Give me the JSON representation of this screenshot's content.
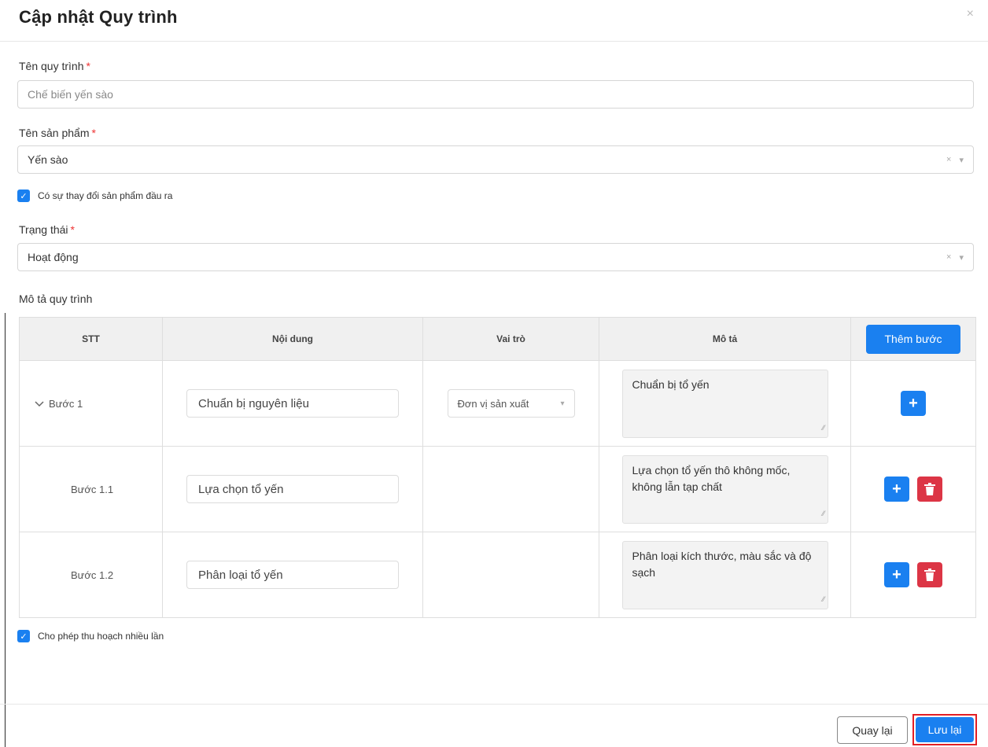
{
  "modal": {
    "title": "Cập nhật Quy trình",
    "close": "×"
  },
  "form": {
    "process_name": {
      "label": "Tên quy trình",
      "required_mark": "*",
      "value": "Chế biến yến sào"
    },
    "product_name": {
      "label": "Tên sản phẩm",
      "required_mark": "*",
      "value": "Yến sào",
      "clear": "×",
      "caret": "▾"
    },
    "output_change": {
      "label": "Có sự thay đổi sản phẩm đầu ra",
      "checked": true
    },
    "status": {
      "label": "Trạng thái",
      "required_mark": "*",
      "value": "Hoạt động",
      "clear": "×",
      "caret": "▾"
    },
    "description_label": "Mô tả quy trình",
    "multi_harvest": {
      "label": "Cho phép thu hoạch nhiều lần",
      "checked": true
    }
  },
  "steps_table": {
    "headers": {
      "stt": "STT",
      "content": "Nội dung",
      "role": "Vai trò",
      "description": "Mô tả"
    },
    "add_step_button": "Thêm bước",
    "rows": [
      {
        "stt": "Bước 1",
        "content": "Chuẩn bị nguyên liệu",
        "role": "Đơn vị sản xuất",
        "description": "Chuẩn bị tổ yến",
        "collapsible": true
      },
      {
        "stt": "Bước 1.1",
        "content": "Lựa chọn tổ yến",
        "role": "",
        "description": "Lựa chọn tổ yến thô không mốc, không lẫn tạp chất"
      },
      {
        "stt": "Bước 1.2",
        "content": "Phân loại tổ yến",
        "role": "",
        "description": "Phân loại kích thước, màu sắc và độ sạch"
      }
    ],
    "icons": {
      "add": "+",
      "delete": "trash-icon",
      "expand": "chevron-down-icon"
    }
  },
  "footer": {
    "back_button": "Quay lại",
    "save_button": "Lưu lại"
  },
  "colors": {
    "primary": "#1a80f0",
    "danger": "#dc3545",
    "highlight": "#e31e24"
  }
}
